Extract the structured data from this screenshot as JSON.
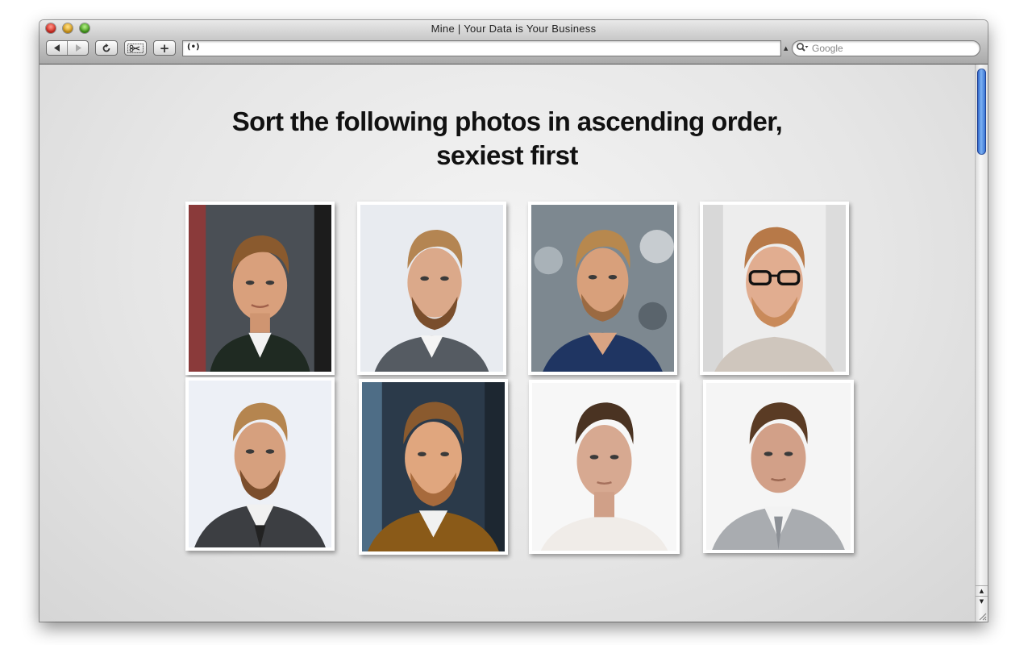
{
  "window": {
    "title": "Mine | Your Data is Your Business"
  },
  "toolbar": {
    "back_icon": "back-arrow-icon",
    "forward_icon": "forward-arrow-icon",
    "reload_icon": "reload-icon",
    "snip_icon": "scissors-icon",
    "add_label": "+",
    "url_icon": "(•)",
    "url_value": "",
    "search_placeholder": "Google"
  },
  "page": {
    "headline_line1": "Sort the following photos in ascending order,",
    "headline_line2": "sexiest first",
    "photos": [
      {
        "description": "portrait-1"
      },
      {
        "description": "portrait-2"
      },
      {
        "description": "portrait-3"
      },
      {
        "description": "portrait-4"
      },
      {
        "description": "portrait-5"
      },
      {
        "description": "portrait-6"
      },
      {
        "description": "portrait-7"
      },
      {
        "description": "portrait-8"
      }
    ]
  },
  "colors": {
    "scroll_thumb": "#3a78d8",
    "content_bg": "#e4e4e4",
    "photo_frame": "#ffffff"
  }
}
